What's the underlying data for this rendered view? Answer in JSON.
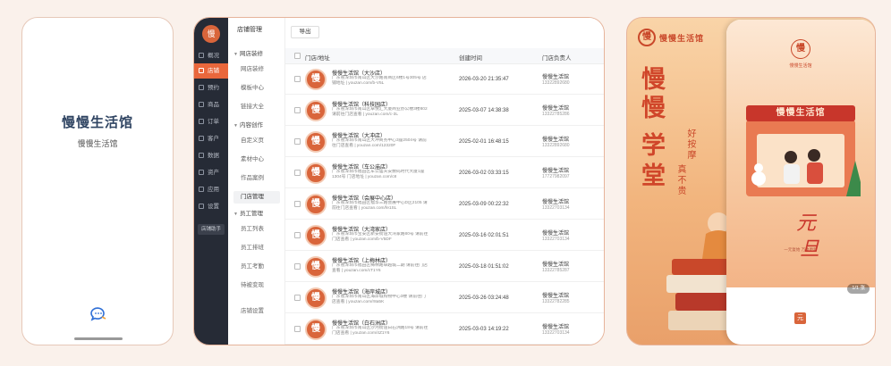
{
  "splash": {
    "title": "慢慢生活馆",
    "subtitle": "慢慢生活馆"
  },
  "admin": {
    "rail": {
      "logo": "慢",
      "items": [
        "概况",
        "店铺",
        "预约",
        "商品",
        "订单",
        "客户",
        "数据",
        "资产",
        "应用",
        "设置"
      ],
      "active_index": 1,
      "bottom_button": "店铺助手"
    },
    "menu": {
      "title": "店铺管理",
      "groups": [
        {
          "label": "网店装修",
          "items": [
            "网店装修",
            "模板中心",
            "链接大全"
          ]
        },
        {
          "label": "内容创作",
          "items": [
            "自定义页",
            "素材中心",
            "作品案例",
            "门店管理"
          ]
        },
        {
          "label": "员工管理",
          "items": [
            "员工列表",
            "员工排班",
            "员工考勤",
            "待被变现"
          ]
        }
      ],
      "active_item": "门店管理",
      "footer": "店铺设置"
    },
    "toolbar": {
      "export_label": "导出"
    },
    "table": {
      "headers": [
        "门店/地址",
        "创建时间",
        "门店负责人"
      ],
      "rows": [
        {
          "name": "慢慢生活馆（大沙店）",
          "address": "广东省深圳市南山区大沙路南商区6楼1号305号 店铺地址 | youzan.com/b-V5L",
          "time": "2026-03-20 21:35:47",
          "owner": "慢慢生活馆",
          "phone": "13322892680"
        },
        {
          "name": "慢慢生活馆（科技园店）",
          "address": "广东省深圳市南山区卓悦汇大厦商业办公楼3楼802 请前往门店查看 | youzan.com/c-3L",
          "time": "2025-03-07 14:38:38",
          "owner": "慢慢生活馆",
          "phone": "13322785286"
        },
        {
          "name": "慢慢生活馆（大冲店）",
          "address": "广东省深圳市南山区大冲商务中心3座2504号 请前往门店查看 | youzan.com/12320F",
          "time": "2025-02-01 16:48:15",
          "owner": "慢慢生活馆",
          "phone": "13322892680"
        },
        {
          "name": "慢慢生活馆（车公庙店）",
          "address": "广东省深圳市福田区车公庙天安数码时代大厦1座1304号 门店地址 | youzan.com/c8",
          "time": "2026-03-02 03:33:15",
          "owner": "慢慢生活馆",
          "phone": "17727982097"
        },
        {
          "name": "慢慢生活馆（会展中心店）",
          "address": "广东省深圳市福田区福华三路会展中心D区2105 请前往门店查看 | youzan.com/fe1SL",
          "time": "2025-03-09 00:22:32",
          "owner": "慢慢生活馆",
          "phone": "13322703134"
        },
        {
          "name": "慢慢生活馆（大湾家店）",
          "address": "广东省深圳市宝安区新安街道大湾家路80号 请前往门店查看 | youzan.com/b-V5DF",
          "time": "2025-03-16 02:01:51",
          "owner": "慢慢生活馆",
          "phone": "13322703134"
        },
        {
          "name": "慢慢生活馆（上梅林店）",
          "address": "广东省深圳市福田区梅林路卓越城二期 请前往门店查看 | youzan.com/cT1Y6",
          "time": "2025-03-18 01:51:02",
          "owner": "慢慢生活馆",
          "phone": "13322785287"
        },
        {
          "name": "慢慢生活馆（海岸城店）",
          "address": "广东省深圳市南山区海岸城购物中心3楼 请前往门店查看 | youzan.com/r8a5K",
          "time": "2025-03-26 03:24:48",
          "owner": "慢慢生活馆",
          "phone": "13322782285"
        },
        {
          "name": "慢慢生活馆（白石洲店）",
          "address": "广东省深圳市南山区沙河街道白石洲路18号 请前往门店查看 | youzan.com/4Z1Y6",
          "time": "2025-03-03 14:19:22",
          "owner": "慢慢生活馆",
          "phone": "13322703134"
        }
      ]
    }
  },
  "poster": {
    "brand_mark": "慢",
    "brand_name": "慢慢生活馆",
    "headline_chars": [
      "慢",
      "慢",
      "学",
      "堂"
    ],
    "slogan_1": "好按摩",
    "slogan_2": "真不贵",
    "front": {
      "logo": "慢",
      "logo_text": "慢慢生活馆",
      "store_sign": "慢慢生活馆",
      "script_1": "元",
      "script_2": "旦",
      "caption": "一元复始 万象更新",
      "page_pill": "1/1 张",
      "mini_logo": "元"
    }
  },
  "colors": {
    "accent": "#e9673c",
    "brand_red": "#c9482a",
    "rail_bg": "#262b36",
    "page_bg": "#faf1eb"
  }
}
